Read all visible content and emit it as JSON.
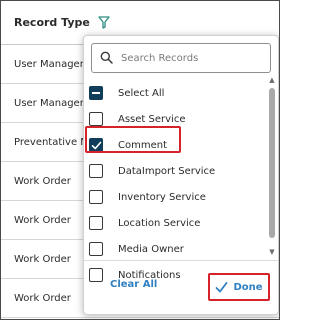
{
  "table": {
    "header": "Record Type",
    "rows": [
      "User Manager",
      "User Manager",
      "Preventative Maintenance",
      "Work Order",
      "Work Order",
      "Work Order",
      "Work Order"
    ]
  },
  "popup": {
    "search_placeholder": "Search Records",
    "items": [
      {
        "label": "Select All",
        "state": "indeterminate"
      },
      {
        "label": "Asset Service",
        "state": "unchecked"
      },
      {
        "label": "Comment",
        "state": "checked"
      },
      {
        "label": "DataImport Service",
        "state": "unchecked"
      },
      {
        "label": "Inventory Service",
        "state": "unchecked"
      },
      {
        "label": "Location Service",
        "state": "unchecked"
      },
      {
        "label": "Media Owner",
        "state": "unchecked"
      },
      {
        "label": "Notifications",
        "state": "unchecked"
      }
    ],
    "clear_label": "Clear All",
    "done_label": "Done"
  },
  "colors": {
    "accent": "#2f7fc1",
    "checkbox_fill": "#0f3d5a",
    "highlight": "#d6232a"
  },
  "icons": {
    "filter": "filter-icon",
    "search": "search-icon",
    "check": "check-icon"
  }
}
